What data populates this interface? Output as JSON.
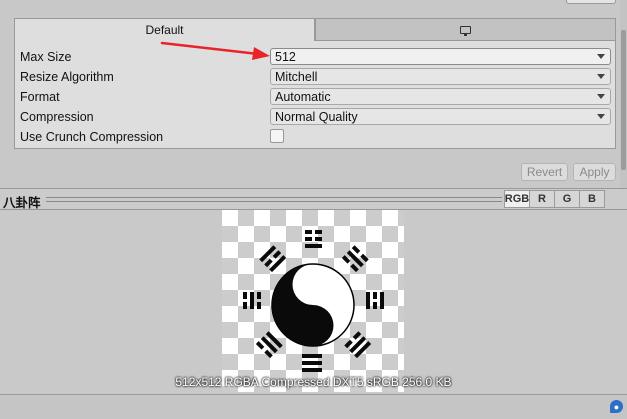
{
  "tabs": [
    {
      "label": "Default"
    },
    {
      "label": "",
      "icon": "monitor-icon"
    }
  ],
  "settings": {
    "max_size": {
      "label": "Max Size",
      "value": "512"
    },
    "resize_algorithm": {
      "label": "Resize Algorithm",
      "value": "Mitchell"
    },
    "format": {
      "label": "Format",
      "value": "Automatic"
    },
    "compression": {
      "label": "Compression",
      "value": "Normal Quality"
    },
    "crunch": {
      "label": "Use Crunch Compression",
      "checked": false
    }
  },
  "actions": {
    "revert": "Revert",
    "apply": "Apply"
  },
  "preview": {
    "title": "八卦阵",
    "channels": [
      "RGB",
      "R",
      "G",
      "B"
    ],
    "active_channel": "RGB",
    "info": "512x512  RGBA Compressed DXT5 sRGB   256.0 KB"
  },
  "annotation_color": "#e8232a"
}
